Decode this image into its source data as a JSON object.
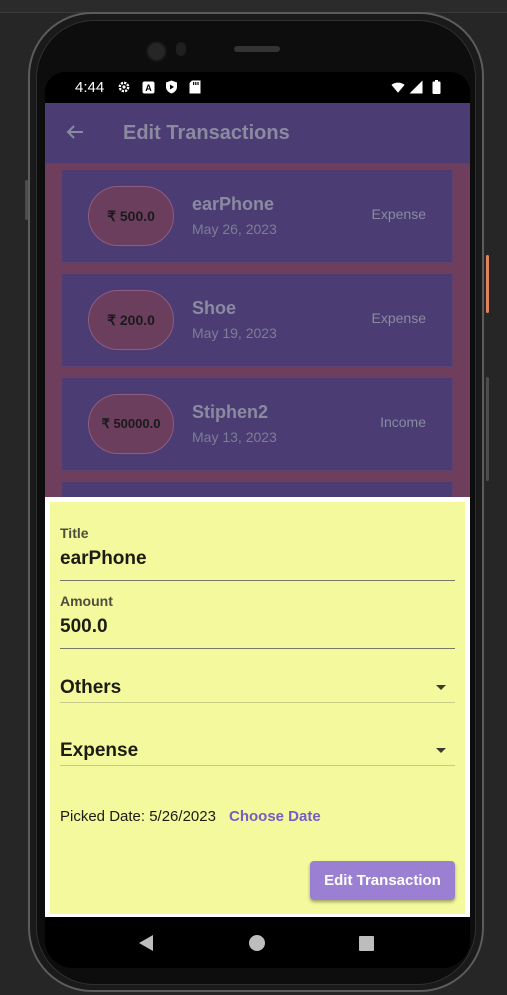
{
  "status_bar": {
    "time": "4:44",
    "left_icons": [
      "settings-icon",
      "a-notification-icon",
      "shield-icon",
      "sd-card-icon"
    ],
    "right_icons": [
      "wifi-icon",
      "cell-signal-icon",
      "battery-icon"
    ]
  },
  "app_bar": {
    "back_icon": "arrow-back-icon",
    "title": "Edit Transactions"
  },
  "transactions": [
    {
      "amount": "₹ 500.0",
      "title": "earPhone",
      "date": "May 26, 2023",
      "type": "Expense"
    },
    {
      "amount": "₹ 200.0",
      "title": "Shoe",
      "date": "May 19, 2023",
      "type": "Expense"
    },
    {
      "amount": "₹ 50000.0",
      "title": "Stiphen2",
      "date": "May 13, 2023",
      "type": "Income"
    }
  ],
  "form": {
    "title_label": "Title",
    "title_value": "earPhone",
    "amount_label": "Amount",
    "amount_value": "500.0",
    "category_selected": "Others",
    "type_selected": "Expense",
    "picked_date_text": "Picked Date: 5/26/2023",
    "choose_date_label": "Choose Date",
    "submit_label": "Edit Transaction"
  },
  "nav_bar": {
    "icons": [
      "nav-back-icon",
      "nav-home-icon",
      "nav-recents-icon"
    ]
  },
  "colors": {
    "app_bar": "#4b3d74",
    "list_background": "#6e3e5c",
    "sheet_background": "#f3f99c",
    "accent": "#9b7fd3",
    "choose_date": "#7a5bc6"
  }
}
